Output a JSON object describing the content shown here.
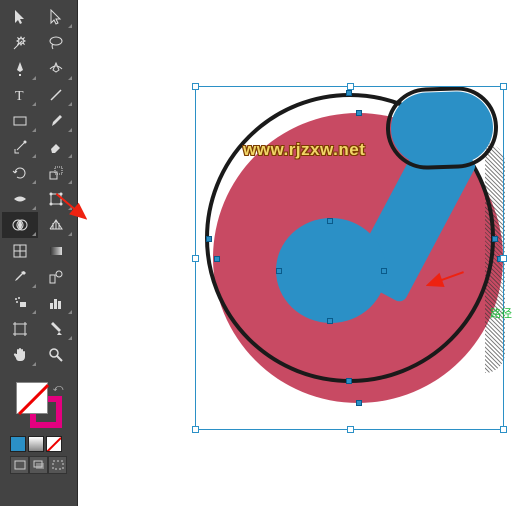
{
  "tools": {
    "row1": [
      "selection",
      "direct-selection"
    ],
    "row2": [
      "magic-wand",
      "lasso"
    ],
    "row3": [
      "pen",
      "curvature"
    ],
    "row4": [
      "type",
      "line-segment"
    ],
    "row5": [
      "rectangle",
      "paintbrush"
    ],
    "row6": [
      "shaper",
      "eraser"
    ],
    "row7": [
      "rotate",
      "scale"
    ],
    "row8": [
      "width",
      "free-transform"
    ],
    "row9": [
      "shape-builder",
      "perspective-grid"
    ],
    "row10": [
      "mesh",
      "gradient"
    ],
    "row11": [
      "eyedropper",
      "blend"
    ],
    "row12": [
      "symbol-sprayer",
      "graph"
    ],
    "row13": [
      "artboard",
      "slice"
    ],
    "row14": [
      "hand",
      "zoom"
    ]
  },
  "swatches": {
    "fill": "none",
    "stroke": "#e4007f",
    "c1": "#2b90c6",
    "c2": "#ffffff"
  },
  "canvas": {
    "watermark": "www.rjzxw.net",
    "path_label": "路径"
  }
}
